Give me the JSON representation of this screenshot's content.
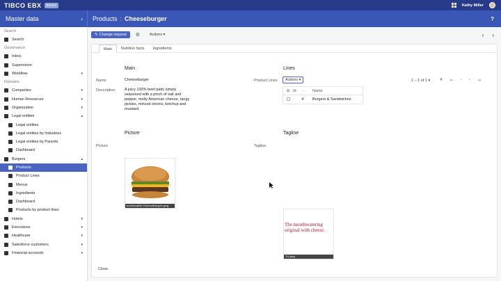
{
  "topbar": {
    "logo": "TIBCO EBX",
    "badge": "demo",
    "user": "Kathy Miller"
  },
  "subbar": {
    "section": "Master data",
    "breadcrumb_parent": "Products",
    "breadcrumb_sep": ":",
    "breadcrumb_current": "Cheeseburger",
    "help": "?"
  },
  "sidebar": {
    "search_section": "Search",
    "search_item": "Search",
    "governance_section": "Governance",
    "governance_items": [
      "Inbox",
      "Supervision",
      "Workflow"
    ],
    "domains_section": "Domains",
    "items": [
      {
        "label": "Companies",
        "caret": "▾"
      },
      {
        "label": "Human Resources",
        "caret": "▾"
      },
      {
        "label": "Organization",
        "caret": "▾"
      },
      {
        "label": "Legal entities",
        "caret": "▴"
      },
      {
        "label": "Legal entities",
        "sub": true
      },
      {
        "label": "Legal entities by Industries",
        "sub": true
      },
      {
        "label": "Legal entities by Parents",
        "sub": true
      },
      {
        "label": "Dashboard",
        "sub": true
      },
      {
        "label": "Burgers",
        "caret": "▴"
      },
      {
        "label": "Products",
        "sub": true,
        "active": true
      },
      {
        "label": "Product Lines",
        "sub": true
      },
      {
        "label": "Menus",
        "sub": true
      },
      {
        "label": "Ingredients",
        "sub": true
      },
      {
        "label": "Dashboard",
        "sub": true
      },
      {
        "label": "Products by product lines",
        "sub": true
      },
      {
        "label": "Hotels",
        "caret": "▾"
      },
      {
        "label": "Executives",
        "caret": "▾"
      },
      {
        "label": "Healthcare",
        "caret": "▾"
      },
      {
        "label": "Salesforce customers",
        "caret": "▾"
      },
      {
        "label": "Financial accounts",
        "caret": "▾"
      }
    ]
  },
  "toolbar": {
    "change_request": "Change request",
    "actions": "Actions ▾"
  },
  "tabs": [
    "Main",
    "Nutrition facts",
    "Ingredients"
  ],
  "main": {
    "group_title": "Main",
    "name_label": "Name",
    "name_value": "Cheeseburger",
    "description_label": "Description",
    "description_value": "A juicy 100% beef patty simply seasoned with a pinch of salt and pepper, melty American cheese, tangy pickles, minced onions, ketchup and mustard.",
    "picture_group": "Picture",
    "picture_label": "Picture",
    "picture_caption": "mcdonalds-Cheeseburger.png",
    "close": "Close"
  },
  "lines": {
    "group_title": "Lines",
    "label": "Product Lines",
    "actions": "Actions ▾",
    "pager": "1 – 1 of 1 ▾",
    "col_id": "Id",
    "col_name": "Name",
    "row_id": "4",
    "row_name": "Burgers & Sandwiches",
    "tagline_group": "Tagline",
    "tagline_label": "Tagline",
    "tagline_text": "The mouthwatering original with cheese.",
    "tagline_caption": "10.png"
  },
  "colors": {
    "topbar": "#283a8a",
    "subbar": "#3a57b7",
    "accent": "#4b63c1",
    "tagline_red": "#c0182c"
  }
}
